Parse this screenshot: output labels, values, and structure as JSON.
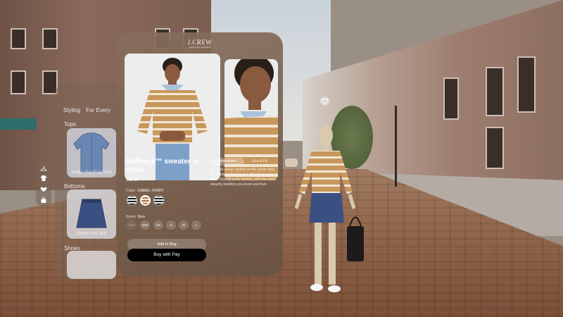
{
  "categories": {
    "tabs": [
      "Styling",
      "For Every"
    ],
    "sections": [
      {
        "label": "Tops",
        "caption": "Indigo chambray shirt"
      },
      {
        "label": "Bottoms",
        "caption": "Denim mini skirt"
      },
      {
        "label": "Shoes",
        "caption": ""
      }
    ]
  },
  "side_tabs": [
    "hanger-icon",
    "sweater-icon",
    "heart-icon",
    "bag-icon"
  ],
  "product": {
    "brand": "J.CREW",
    "brand_sub": "AMERICAN GARMENT",
    "name": "Rollneck™ sweater in stripe",
    "price": "$69.50",
    "color_label": "Color",
    "color_value": "CAMEL IVORY",
    "swatch_count": 3,
    "selected_swatch": 1,
    "sizes_label": "Sizes",
    "size_value": "Size",
    "sizes": [
      {
        "label": "XXS",
        "available": false
      },
      {
        "label": "XXS",
        "available": true
      },
      {
        "label": "XS",
        "available": true
      },
      {
        "label": "S",
        "available": true
      },
      {
        "label": "M",
        "available": true
      },
      {
        "label": "L",
        "available": true
      }
    ],
    "add_to_bag": "Add to Bag",
    "buy_with_pay": "Buy with  Pay",
    "tabs": {
      "description": "Description",
      "size": "Size & Fit"
    },
    "description": "An even easier update on the iconic style. We tweaked the fit just a little bit to make it more relaxed at the bottom, with the same slouchy neckline you know and love."
  },
  "favorite_icon": "heart-icon",
  "colors": {
    "accent_tan": "#c8975b",
    "stripe_ivory": "#f1e6d6",
    "skirt_denim": "#3c4f82"
  }
}
